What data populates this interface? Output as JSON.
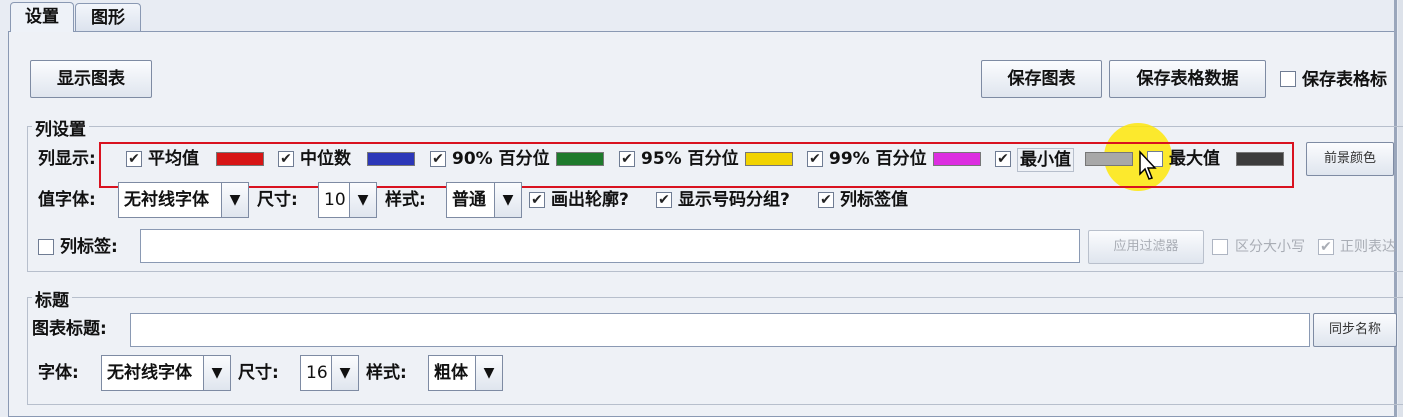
{
  "tabs": [
    {
      "label": "设置"
    },
    {
      "label": "图形"
    }
  ],
  "toolbar": {
    "show_chart": "显示图表",
    "save_chart": "保存图表",
    "save_table_data": "保存表格数据",
    "save_table_label": "保存表格标"
  },
  "column_settings": {
    "title": "列设置",
    "display_label": "列显示:",
    "series": [
      {
        "label": "平均值",
        "checked": true,
        "color": "#d71515"
      },
      {
        "label": "中位数",
        "checked": true,
        "color": "#2c37b8"
      },
      {
        "label": "90% 百分位",
        "checked": true,
        "color": "#1e7a2c"
      },
      {
        "label": "95% 百分位",
        "checked": true,
        "color": "#f2d300"
      },
      {
        "label": "99% 百分位",
        "checked": true,
        "color": "#dc2ee0"
      },
      {
        "label": "最小值",
        "checked": true,
        "color": "#a8a8a8"
      },
      {
        "label": "最大值",
        "checked": false,
        "color": "#3c3c3c"
      }
    ],
    "foreground_color": "前景颜色",
    "value_font_label": "值字体:",
    "value_font": "无衬线字体",
    "size_label": "尺寸:",
    "size": "10",
    "style_label": "样式:",
    "style": "普通",
    "draw_outline": "画出轮廓?",
    "show_number_grouping": "显示号码分组?",
    "column_label_value": "列标签值",
    "column_label": "列标签:",
    "apply_filter": "应用过滤器",
    "case_sensitive": "区分大小写",
    "regex": "正则表达"
  },
  "title_section": {
    "title": "标题",
    "chart_title_label": "图表标题:",
    "chart_title": "",
    "sync_name": "同步名称",
    "font_label": "字体:",
    "font": "无衬线字体",
    "size_label": "尺寸:",
    "size": "16",
    "style_label": "样式:",
    "style": "粗体"
  },
  "check_mark": "✔",
  "combo_arrow": "▼"
}
